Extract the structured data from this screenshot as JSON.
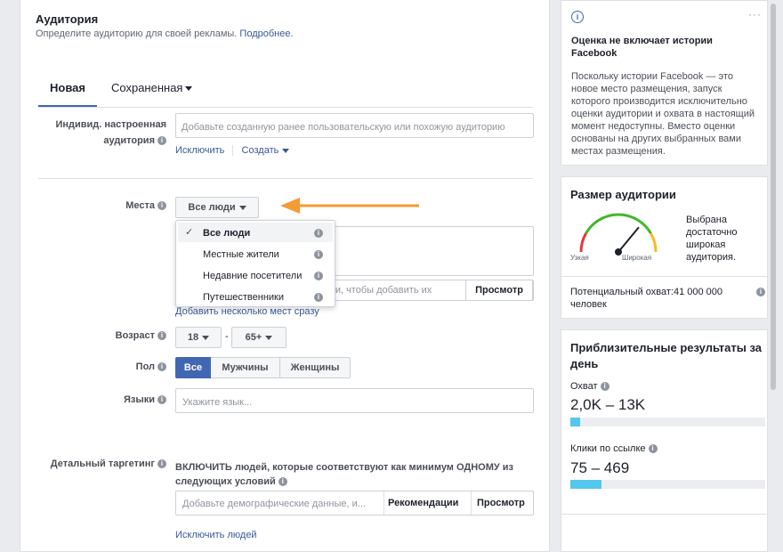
{
  "audience": {
    "title": "Аудитория",
    "subtitle": "Определите аудиторию для своей рекламы.",
    "more_link": "Подробнее.",
    "tabs": [
      "Новая",
      "Сохраненная"
    ],
    "custom_audience_label_1": "Индивид. настроенная",
    "custom_audience_label_2": "аудитория",
    "custom_audience_placeholder": "Добавьте созданную ранее пользовательскую или похожую аудиторию",
    "exclude_link": "Исключить",
    "create_link": "Создать",
    "locations_label": "Места",
    "locations_dropdown": "Все люди",
    "location_options": [
      "Все люди",
      "Местные жители",
      "Недавние посетители",
      "Путешественники"
    ],
    "location_search_placeholder": "ки, чтобы добавить их",
    "browse_button": "Просмотр",
    "add_multiple_link": "Добавить несколько мест сразу",
    "age_label": "Возраст",
    "age_from": "18",
    "age_to": "65+",
    "age_dash": "-",
    "gender_label": "Пол",
    "gender_options": [
      "Все",
      "Мужчины",
      "Женщины"
    ],
    "languages_label": "Языки",
    "languages_placeholder": "Укажите язык...",
    "detailed_label": "Детальный таргетинг",
    "detailed_include_1": "ВКЛЮЧИТЬ людей, которые соответствуют как минимум ОДНОМУ из",
    "detailed_include_2": "следующих условий",
    "detailed_placeholder": "Добавьте демографические данные, и...",
    "recommendations_button": "Рекомендации",
    "detailed_browse_button": "Просмотр",
    "exclude_people_link": "Исключить людей"
  },
  "notice": {
    "title_1": "Оценка не включает истории",
    "title_2": "Facebook",
    "body": [
      "Поскольку истории Facebook — это",
      "новое место размещения, запуск",
      "которого производится исключительно",
      "оценки аудитории и охвата в настоящий",
      "момент недоступны. Вместо оценки",
      "основаны на других выбранных вами",
      "местах размещения."
    ]
  },
  "size": {
    "title": "Размер аудитории",
    "narrow": "Узкая",
    "wide": "Широкая",
    "description": [
      "Выбрана",
      "достаточно",
      "широкая",
      "аудитория."
    ],
    "potential_1": "Потенциальный охват:41 000 000",
    "potential_2": "человек",
    "gauge_level": 0.72
  },
  "results": {
    "title_1": "Приблизительные результаты за",
    "title_2": "день",
    "reach_label": "Охват",
    "reach_value": "2,0K – 13K",
    "reach_fill": 0.05,
    "clicks_label": "Клики по ссылке",
    "clicks_value": "75 – 469",
    "clicks_fill": 0.16
  },
  "colors": {
    "accent": "#4267b2",
    "arrow": "#f59a35",
    "bar": "#54c7ec"
  }
}
